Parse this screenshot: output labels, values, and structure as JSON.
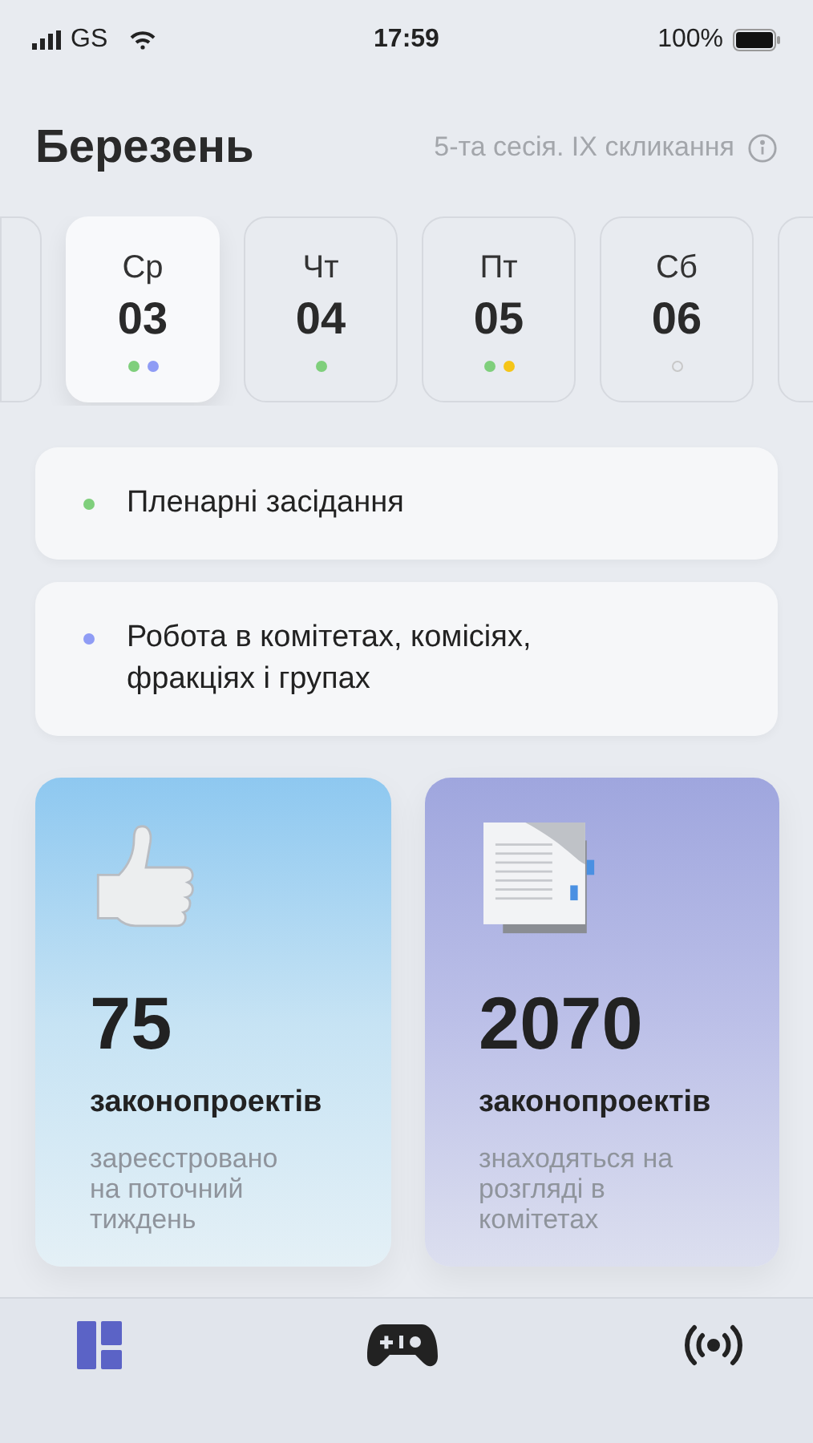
{
  "status_bar": {
    "carrier": "GS",
    "time": "17:59",
    "battery": "100%"
  },
  "header": {
    "month": "Березень",
    "session": "5-та сесія. IX скликання"
  },
  "days": [
    {
      "weekday": "Ср",
      "date": "03",
      "selected": true,
      "dots": [
        {
          "color": "#7fcf7c",
          "hollow": false
        },
        {
          "color": "#8f9cf5",
          "hollow": false
        }
      ]
    },
    {
      "weekday": "Чт",
      "date": "04",
      "selected": false,
      "dots": [
        {
          "color": "#7fcf7c",
          "hollow": false
        }
      ]
    },
    {
      "weekday": "Пт",
      "date": "05",
      "selected": false,
      "dots": [
        {
          "color": "#7fcf7c",
          "hollow": false
        },
        {
          "color": "#f5c518",
          "hollow": false
        }
      ]
    },
    {
      "weekday": "Сб",
      "date": "06",
      "selected": false,
      "dots": [
        {
          "color": "#c8c8c8",
          "hollow": true
        }
      ]
    }
  ],
  "legend": [
    {
      "label": "Пленарні засідання",
      "color": "#7fcf7c"
    },
    {
      "label": "Робота в комітетах, комісіях, фракціях і групах",
      "color": "#8f9cf5"
    }
  ],
  "stats": [
    {
      "kind": "thumb",
      "count": "75",
      "unit": "законопроектів",
      "note": "зареєстровано на поточний тиждень"
    },
    {
      "kind": "document",
      "count": "2070",
      "unit": "законопроектів",
      "note": "знаходяться на розгляді в комітетах"
    }
  ],
  "tabs": [
    {
      "kind": "grid",
      "selected": true
    },
    {
      "kind": "gamepad",
      "selected": false
    },
    {
      "kind": "broadcast",
      "selected": false
    }
  ]
}
